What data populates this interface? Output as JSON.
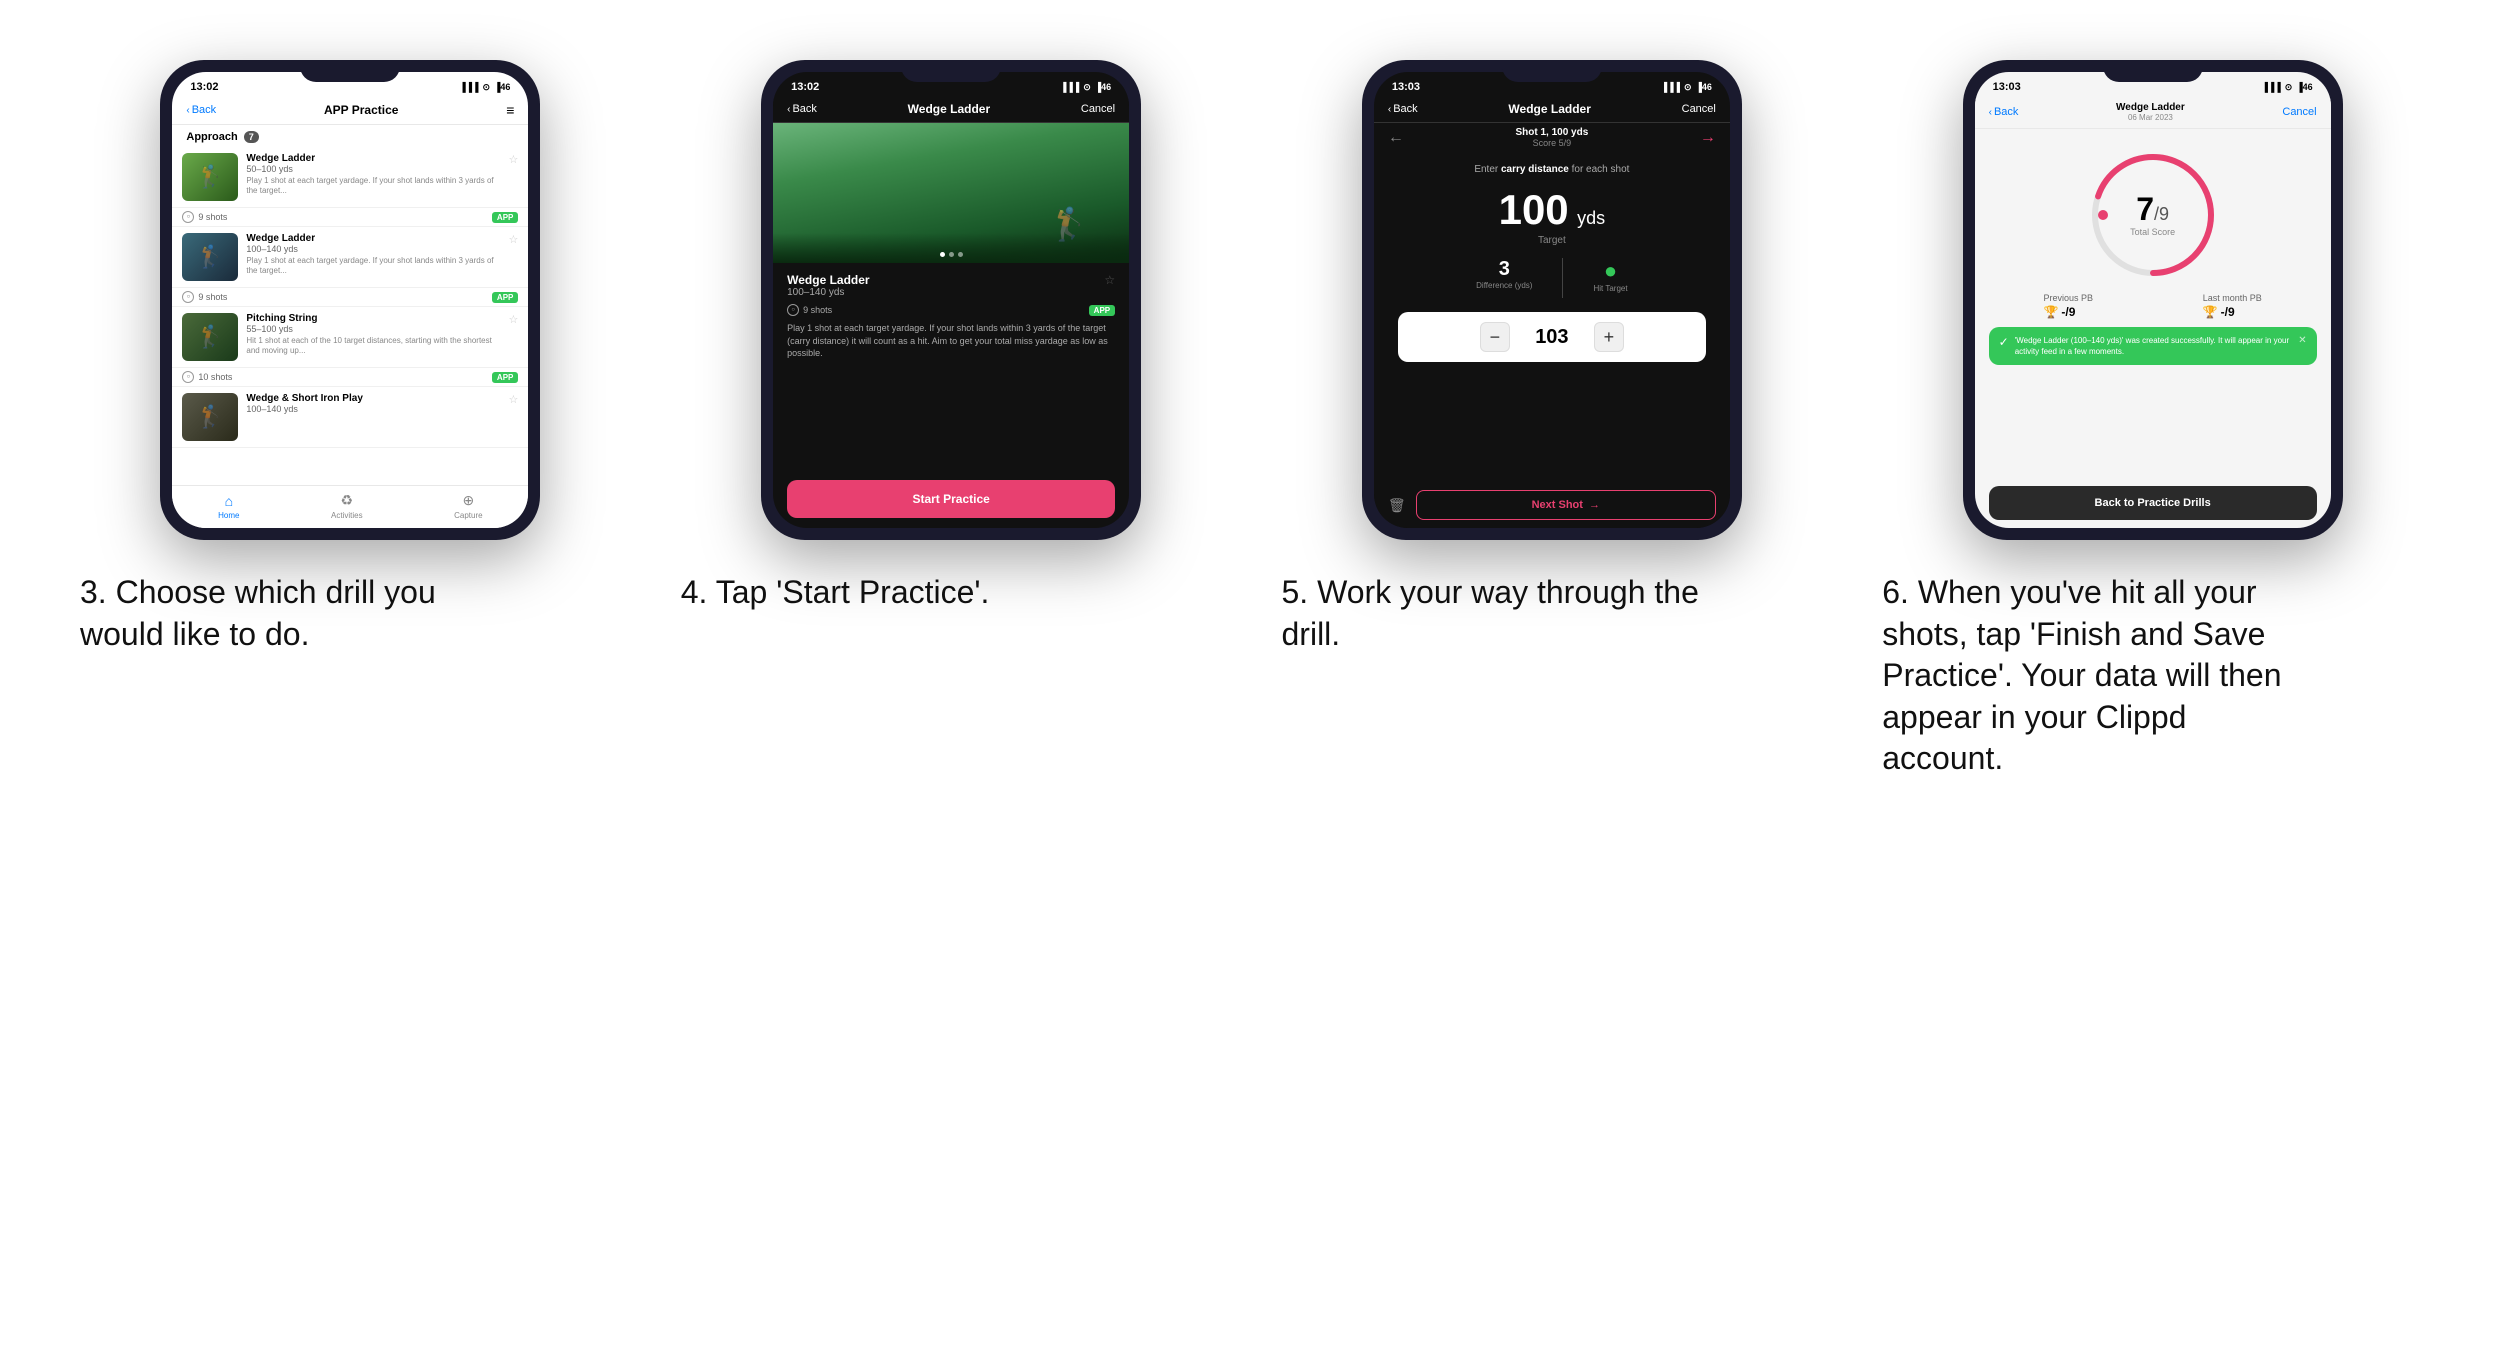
{
  "page": {
    "background": "#ffffff"
  },
  "steps": [
    {
      "number": "3",
      "caption": "3. Choose which drill you would like to do."
    },
    {
      "number": "4",
      "caption": "4. Tap 'Start Practice'."
    },
    {
      "number": "5",
      "caption": "5. Work your way through the drill."
    },
    {
      "number": "6",
      "caption": "6. When you've hit all your shots, tap 'Finish and Save Practice'. Your data will then appear in your Clippd account."
    }
  ],
  "phone1": {
    "time": "13:02",
    "back_label": "Back",
    "title": "APP Practice",
    "category": "Approach",
    "category_count": "7",
    "drills": [
      {
        "name": "Wedge Ladder",
        "yds": "50–100 yds",
        "desc": "Play 1 shot at each target yardage. If your shot lands within 3 yards of the target...",
        "shots": "9 shots",
        "badge": "APP"
      },
      {
        "name": "Wedge Ladder",
        "yds": "100–140 yds",
        "desc": "Play 1 shot at each target yardage. If your shot lands within 3 yards of the target...",
        "shots": "9 shots",
        "badge": "APP"
      },
      {
        "name": "Pitching String",
        "yds": "55–100 yds",
        "desc": "Hit 1 shot at each of the 10 target distances, starting with the shortest and moving up...",
        "shots": "10 shots",
        "badge": "APP"
      },
      {
        "name": "Wedge & Short Iron Play",
        "yds": "100–140 yds",
        "desc": "",
        "shots": "",
        "badge": ""
      }
    ],
    "nav_home": "Home",
    "nav_activities": "Activities",
    "nav_capture": "Capture"
  },
  "phone2": {
    "time": "13:02",
    "back_label": "Back",
    "title": "Wedge Ladder",
    "cancel_label": "Cancel",
    "drill_name": "Wedge Ladder",
    "drill_yds": "100–140 yds",
    "shots": "9 shots",
    "badge": "APP",
    "desc": "Play 1 shot at each target yardage. If your shot lands within 3 yards of the target (carry distance) it will count as a hit. Aim to get your total miss yardage as low as possible.",
    "start_btn": "Start Practice"
  },
  "phone3": {
    "time": "13:03",
    "back_label": "Back",
    "header_title": "Wedge Ladder",
    "cancel_label": "Cancel",
    "shot_label": "Shot 1, 100 yds",
    "score_label": "Score 5/9",
    "instruction": "Enter carry distance for each shot",
    "target_yds": "100",
    "target_unit": "yds",
    "target_label": "Target",
    "difference": "3",
    "difference_label": "Difference (yds)",
    "hit_target_label": "Hit Target",
    "input_value": "103",
    "next_shot_label": "Next Shot"
  },
  "phone4": {
    "time": "13:03",
    "back_label": "Back",
    "header_title": "Wedge Ladder",
    "header_date": "06 Mar 2023",
    "cancel_label": "Cancel",
    "score": "7",
    "denom": "/9",
    "score_label": "Total Score",
    "prev_pb_title": "Previous PB",
    "prev_pb_val": "-/9",
    "last_month_pb_title": "Last month PB",
    "last_month_pb_val": "-/9",
    "toast_text": "'Wedge Ladder (100–140 yds)' was created successfully. It will appear in your activity feed in a few moments.",
    "back_btn": "Back to Practice Drills"
  },
  "icons": {
    "back_chevron": "‹",
    "menu": "≡",
    "star_empty": "☆",
    "star_filled": "★",
    "signal": "▐▐▐",
    "wifi": "WiFi",
    "battery": "46",
    "check": "✓",
    "cross": "✕",
    "arrow_right": "→",
    "arrow_left": "←",
    "trash": "🗑",
    "trophy": "🏆",
    "home_icon": "⌂",
    "activities_icon": "♻",
    "capture_icon": "⊕",
    "clock_icon": "○",
    "minus": "−",
    "plus": "+"
  }
}
